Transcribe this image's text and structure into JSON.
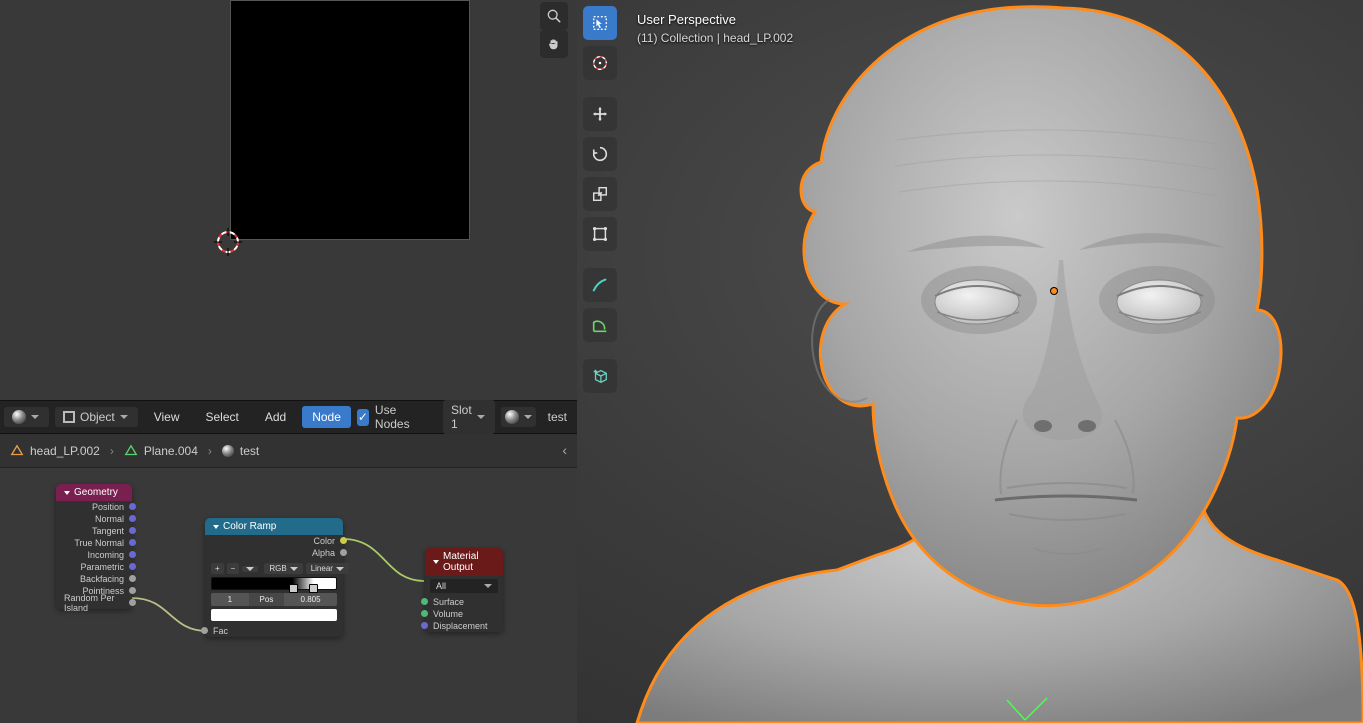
{
  "node_header": {
    "mode_label": "Object",
    "menu_view": "View",
    "menu_select": "Select",
    "menu_add": "Add",
    "menu_node": "Node",
    "use_nodes_label": "Use Nodes",
    "slot_label": "Slot 1",
    "mat_name": "test"
  },
  "breadcrumb": {
    "obj": "head_LP.002",
    "mesh": "Plane.004",
    "mat": "test"
  },
  "nodes": {
    "geometry": {
      "title": "Geometry",
      "outs": [
        "Position",
        "Normal",
        "Tangent",
        "True Normal",
        "Incoming",
        "Parametric",
        "Backfacing",
        "Pointiness",
        "Random Per Island"
      ]
    },
    "color_ramp": {
      "title": "Color Ramp",
      "out_color": "Color",
      "out_alpha": "Alpha",
      "interp_mode": "RGB",
      "interp_type": "Linear",
      "stop_index": "1",
      "pos_label": "Pos",
      "pos_value": "0.805",
      "in_fac": "Fac"
    },
    "mat_output": {
      "title": "Material Output",
      "target": "All",
      "in_surface": "Surface",
      "in_volume": "Volume",
      "in_displacement": "Displacement"
    }
  },
  "viewport": {
    "overlay_line1": "User Perspective",
    "overlay_line2": "(11) Collection | head_LP.002"
  }
}
